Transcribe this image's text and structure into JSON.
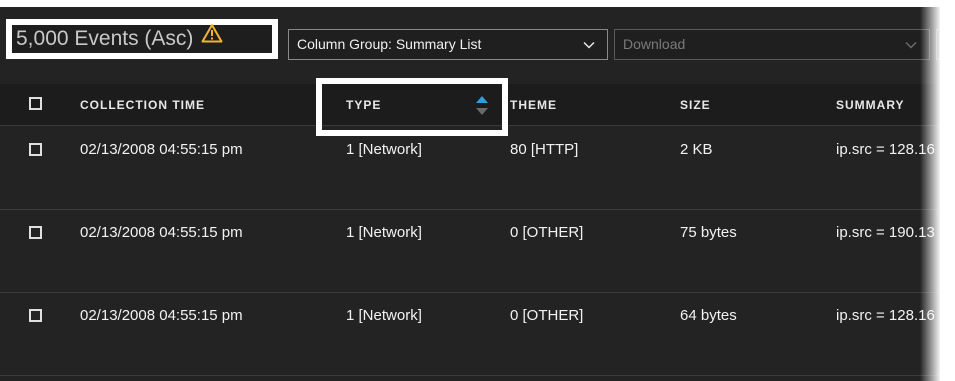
{
  "toolbar": {
    "events_title": "5,000 Events (Asc)",
    "column_group": "Column Group: Summary List",
    "download": "Download"
  },
  "table": {
    "headers": {
      "collection_time": "COLLECTION TIME",
      "type": "TYPE",
      "theme": "THEME",
      "size": "SIZE",
      "summary": "SUMMARY"
    },
    "rows": [
      {
        "collection_time": "02/13/2008 04:55:15 pm",
        "type": "1 [Network]",
        "theme": "80 [HTTP]",
        "size": "2 KB",
        "summary": "ip.src = 128.16"
      },
      {
        "collection_time": "02/13/2008 04:55:15 pm",
        "type": "1 [Network]",
        "theme": "0 [OTHER]",
        "size": "75 bytes",
        "summary": "ip.src = 190.13"
      },
      {
        "collection_time": "02/13/2008 04:55:15 pm",
        "type": "1 [Network]",
        "theme": "0 [OTHER]",
        "size": "64 bytes",
        "summary": "ip.src = 128.16"
      }
    ]
  },
  "icons": {
    "warning": "warning-icon",
    "sort": "sort-icon",
    "chevron": "chevron-down-icon"
  },
  "colors": {
    "background": "#232323",
    "warning": "#f2b233",
    "sort_active": "#2f9ee0",
    "highlight": "#ffffff"
  }
}
